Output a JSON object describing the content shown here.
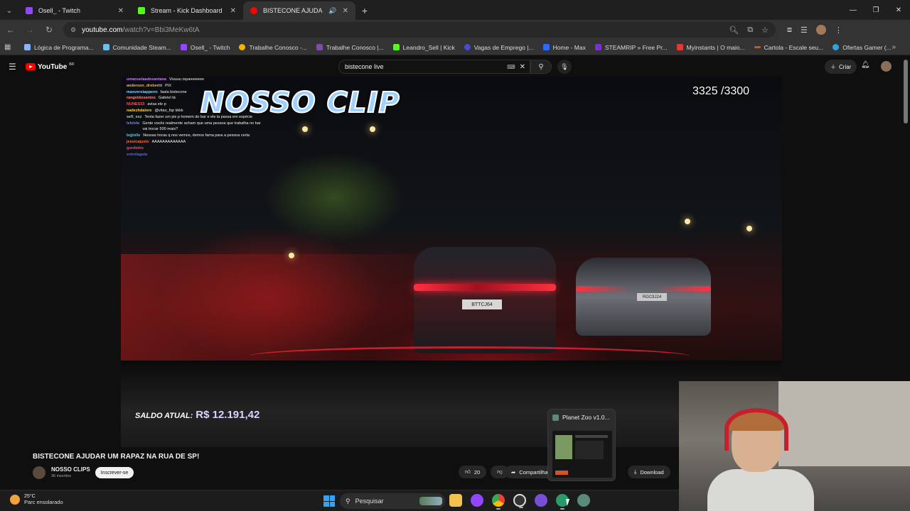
{
  "browser": {
    "tabs": [
      {
        "label": "Osell_ - Twitch",
        "icon": "twitch-icon",
        "color": "#9146ff",
        "active": false
      },
      {
        "label": "Stream - Kick Dashboard",
        "icon": "kick-icon",
        "color": "#53fc18",
        "active": false
      },
      {
        "label": "BISTECONE AJUDAR UM R",
        "icon": "youtube-icon",
        "color": "#ff0000",
        "active": true
      }
    ],
    "new_tab": "+",
    "url_host": "youtube.com",
    "url_path": "/watch?v=Bbi3MeKw6tA",
    "bookmarks": [
      {
        "label": "Lógica de Programa...",
        "color": "#8ab4f8"
      },
      {
        "label": "Comunidade Steam...",
        "color": "#66c0f4"
      },
      {
        "label": "Osell_ - Twitch",
        "color": "#9146ff"
      },
      {
        "label": "Trabalhe Conosco -...",
        "color": "#f4b400"
      },
      {
        "label": "Trabalhe Conosco |...",
        "color": "#7b4ea8"
      },
      {
        "label": "Leandro_Sell | Kick",
        "color": "#53fc18"
      },
      {
        "label": "Vagas de Emprego |...",
        "color": "#4a4ad8"
      },
      {
        "label": "Home - Max",
        "color": "#2b6bff"
      },
      {
        "label": "STEAMRIP » Free Pr...",
        "color": "#7a2fd0"
      },
      {
        "label": "Myinstants | O maio...",
        "color": "#e53935"
      },
      {
        "label": "Cartola - Escale seu...",
        "color": "#e65100"
      },
      {
        "label": "Ofertas Gamer (...",
        "color": "#2aa5e0"
      }
    ]
  },
  "youtube": {
    "logo": "YouTube",
    "region": "BR",
    "search_value": "bistecone live",
    "create_label": "Criar"
  },
  "video": {
    "clip_title": "NOSSO CLIP",
    "counter": "3325 /3300",
    "saldo_label": "SALDO ATUAL:",
    "saldo_value": "R$ 12.191,42",
    "plate1": "BTTCJ64",
    "plate2": "RGC9J24",
    "chat": [
      {
        "user": "umanuelaadesantana",
        "msg": "Viuuuu oqueeeeeee",
        "color": "#c77dff"
      },
      {
        "user": "anderson_drebertti",
        "msg": "PIX",
        "color": "#ffb347"
      },
      {
        "user": "maxverstappenn",
        "msg": "faala bistecone",
        "color": "#7fd6ff"
      },
      {
        "user": "rangeldosantos",
        "msg": "Gabriel tá",
        "color": "#ff8a80"
      },
      {
        "user": "NUNES33",
        "msg": "avisa ele p",
        "color": "#ff5252"
      },
      {
        "user": "nadezhdalore",
        "msg": "@vitao_fsp kkkk",
        "color": "#ffd54f"
      },
      {
        "user": "sefi_xxz",
        "msg": "Tenta fazer um pix p homem do bar e ele la passa em espécie",
        "color": "#a5d6a7"
      },
      {
        "user": "lelelele",
        "msg": "Gente vocês realmente acham que uma pessoa que trabalha no bar vai trocar 500 reais?",
        "color": "#7986cb"
      },
      {
        "user": "bqjiolle",
        "msg": "Nessas horas q nos vemos, demos fama para a pessoa certa",
        "color": "#4dd0e1"
      },
      {
        "user": "jessicajusto",
        "msg": "AAAAAAAAAAAAA",
        "color": "#ff6e40"
      },
      {
        "user": "gordinho",
        "msg": "",
        "color": "#ff4081"
      },
      {
        "user": "estrelaguia",
        "msg": "",
        "color": "#5c6bc0"
      }
    ],
    "title": "BISTECONE AJUDAR UM RAPAZ NA RUA DE SP!",
    "channel_name": "NOSSO CLIPS",
    "channel_subs": "36 inscritos",
    "subscribe_label": "Inscrever-se",
    "likes": "20",
    "share_label": "Compartilhar",
    "download_label": "Download"
  },
  "taskbar_preview": {
    "title": "Planet Zoo v1.0..."
  },
  "taskbar": {
    "weather_temp": "25°C",
    "weather_desc": "Parc ensolarado",
    "search_placeholder": "Pesquisar"
  }
}
